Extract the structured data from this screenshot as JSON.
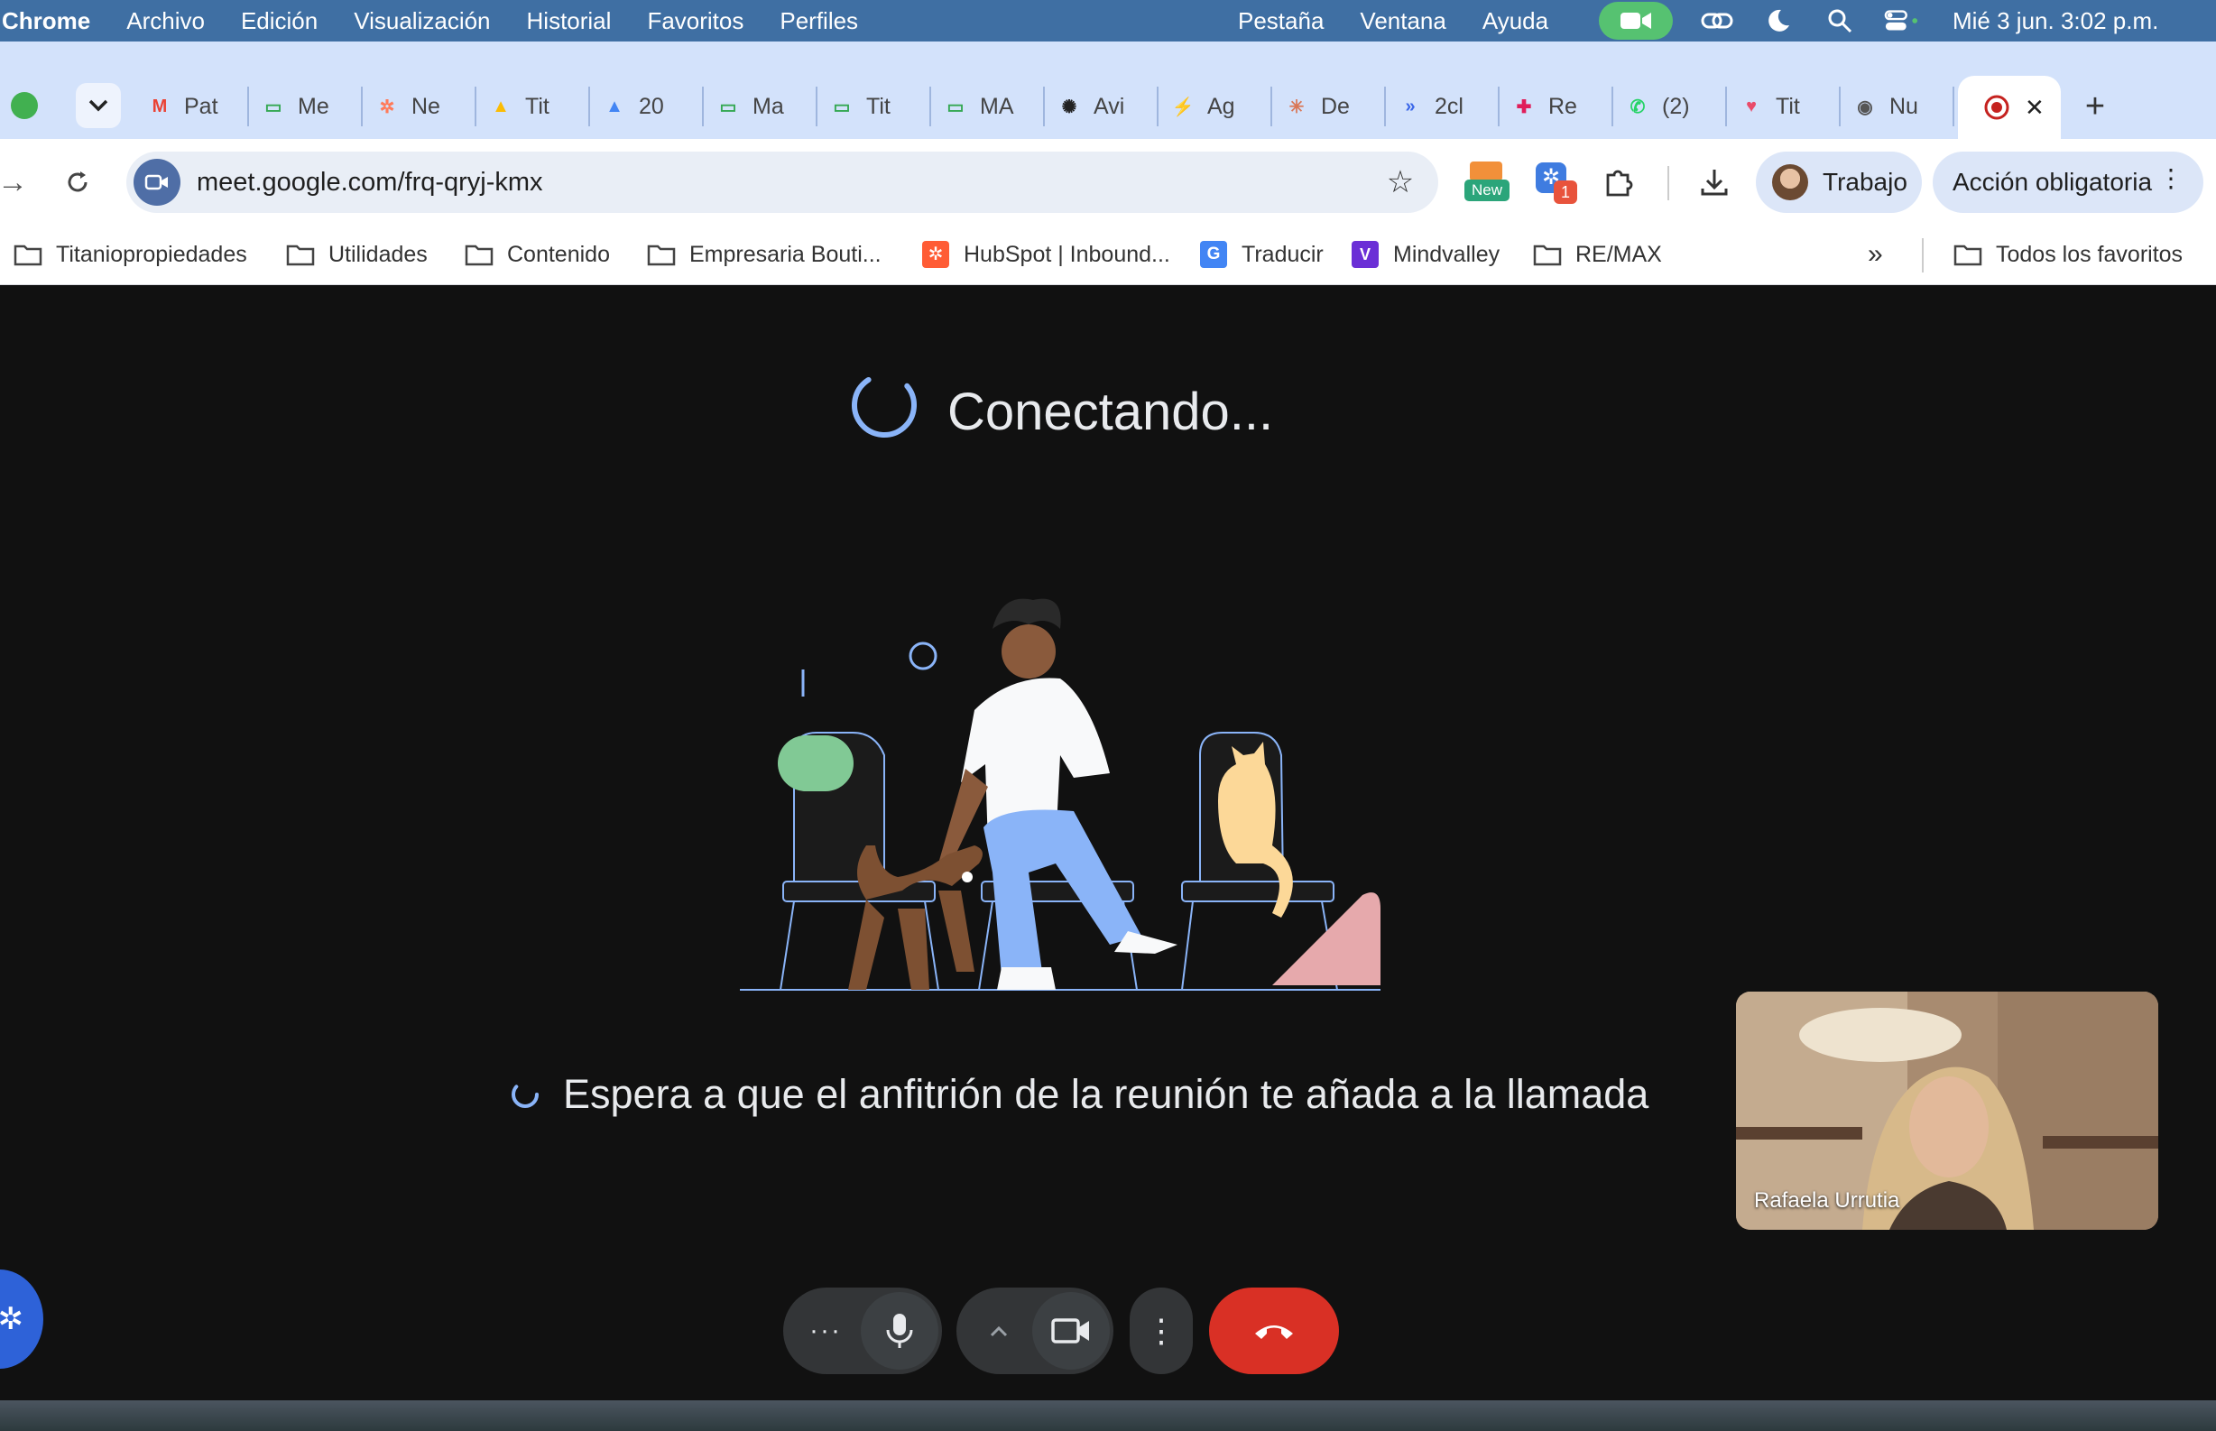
{
  "menubar": {
    "app": "Chrome",
    "menus": [
      "Archivo",
      "Edición",
      "Visualización",
      "Historial",
      "Favoritos",
      "Perfiles"
    ],
    "right_menus": [
      "Pestaña",
      "Ventana",
      "Ayuda"
    ],
    "clock": "Mié 3 jun.  3:02 p.m."
  },
  "tabs": [
    {
      "label": "Pat",
      "icon": "gmail-icon",
      "color": "#ea4335",
      "glyph": "M"
    },
    {
      "label": "Me",
      "icon": "meet-icon",
      "color": "#34a853",
      "glyph": "▭"
    },
    {
      "label": "Ne",
      "icon": "hubspot-icon",
      "color": "#ff7a59",
      "glyph": "✲"
    },
    {
      "label": "Tit",
      "icon": "drive-icon",
      "color": "#fbbc04",
      "glyph": "▲"
    },
    {
      "label": "20",
      "icon": "drive-icon",
      "color": "#4285f4",
      "glyph": "▲"
    },
    {
      "label": "Ma",
      "icon": "meet-icon",
      "color": "#34a853",
      "glyph": "▭"
    },
    {
      "label": "Tit",
      "icon": "meet-icon",
      "color": "#34a853",
      "glyph": "▭"
    },
    {
      "label": "MA",
      "icon": "meet-icon",
      "color": "#34a853",
      "glyph": "▭"
    },
    {
      "label": "Avi",
      "icon": "openai-icon",
      "color": "#222222",
      "glyph": "✺"
    },
    {
      "label": "Ag",
      "icon": "bolt-icon",
      "color": "#1f7a4a",
      "glyph": "⚡"
    },
    {
      "label": "De",
      "icon": "claude-icon",
      "color": "#d97757",
      "glyph": "✳"
    },
    {
      "label": "2cl",
      "icon": "arrow-icon",
      "color": "#3a66e8",
      "glyph": "»"
    },
    {
      "label": "Re",
      "icon": "slack-icon",
      "color": "#e01e5a",
      "glyph": "✚"
    },
    {
      "label": "(2)",
      "icon": "whatsapp-icon",
      "color": "#25d366",
      "glyph": "✆"
    },
    {
      "label": "Tit",
      "icon": "heart-icon",
      "color": "#e94b6a",
      "glyph": "♥"
    },
    {
      "label": "Nu",
      "icon": "chrome-icon",
      "color": "#555555",
      "glyph": "◉"
    }
  ],
  "active_tab": {
    "icon": "record-icon",
    "close": "✕"
  },
  "toolbar": {
    "url": "meet.google.com/frq-qryj-kmx",
    "ext_badge_new": "New",
    "ext_badge_count": "1",
    "profile_label": "Trabajo",
    "action_label": "Acción obligatoria"
  },
  "bookmarks": [
    {
      "label": "Titaniopropiedades",
      "icon": "folder-icon"
    },
    {
      "label": "Utilidades",
      "icon": "folder-icon"
    },
    {
      "label": "Contenido",
      "icon": "folder-icon"
    },
    {
      "label": "Empresaria Bouti...",
      "icon": "folder-icon"
    },
    {
      "label": "HubSpot | Inbound...",
      "icon": "hubspot-icon"
    },
    {
      "label": "Traducir",
      "icon": "translate-icon"
    },
    {
      "label": "Mindvalley",
      "icon": "mindvalley-icon"
    },
    {
      "label": "RE/MAX",
      "icon": "folder-icon"
    }
  ],
  "bookmarks_overflow": "»",
  "all_bookmarks": "Todos los favoritos",
  "meet": {
    "connecting": "Conectando...",
    "waiting": "Espera a que el anfitrión de la reunión te añada a la llamada",
    "self_name": "Rafaela Urrutia"
  },
  "colors": {
    "accent_blue": "#4285f4",
    "hangup_red": "#d93025",
    "background": "#111111"
  }
}
